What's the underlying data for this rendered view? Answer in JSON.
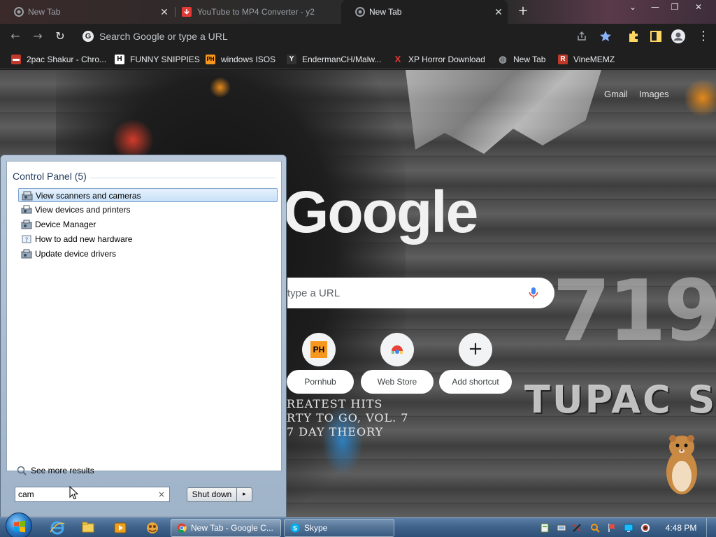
{
  "browser": {
    "tabs": [
      {
        "title": "New Tab",
        "active": false
      },
      {
        "title": "YouTube to MP4 Converter - y2",
        "active": false
      },
      {
        "title": "New Tab",
        "active": true
      }
    ],
    "new_tab_symbol": "+",
    "window_controls": {
      "menu": "⌄",
      "minimize": "—",
      "maximize": "❐",
      "close": "✕"
    },
    "toolbar": {
      "back_icon": "←",
      "forward_icon": "→",
      "reload_icon": "↻",
      "omnibox_placeholder": "Search Google or type a URL",
      "google_letter": "G"
    },
    "bookmarks": [
      {
        "label": "2pac Shakur - Chro...",
        "icon": "page-icon",
        "icon_char": "▬",
        "icon_bg": "#c0392b"
      },
      {
        "label": "FUNNY SNIPPIES",
        "icon": "h-icon",
        "icon_char": "H",
        "icon_bg": "#ffffff"
      },
      {
        "label": "windows ISOS",
        "icon": "ph-icon",
        "icon_char": "PH",
        "icon_bg": "#f7971d"
      },
      {
        "label": "EndermanCH/Malw...",
        "icon": "yp-icon",
        "icon_char": "Y",
        "icon_bg": "#333333"
      },
      {
        "label": "XP Horror Download",
        "icon": "x-icon",
        "icon_char": "X",
        "icon_bg": "#1f1f1f"
      },
      {
        "label": "New Tab",
        "icon": "globe-icon",
        "icon_char": "◍",
        "icon_bg": "#1f1f1f"
      },
      {
        "label": "VineMEMZ",
        "icon": "r-icon",
        "icon_char": "R",
        "icon_bg": "#c0392b"
      }
    ]
  },
  "ntp": {
    "top_links": {
      "gmail": "Gmail",
      "images": "Images"
    },
    "logo_text": "Google",
    "search_placeholder": "type a URL",
    "shortcuts": [
      {
        "label": "Pornhub",
        "icon": "ph-icon",
        "icon_char": "PH"
      },
      {
        "label": "Web Store",
        "icon": "web-store-icon",
        "icon_char": ""
      },
      {
        "label": "Add shortcut",
        "icon": "plus-icon",
        "icon_char": "+"
      }
    ],
    "album_lines": [
      "REATEST HITS",
      "RTY TO GO, VOL. 7",
      "7 DAY THEORY"
    ],
    "big_number": "719",
    "artist_text": "TUPAC SH"
  },
  "start_menu": {
    "section_title": "Control Panel (5)",
    "items": [
      {
        "label": "View scanners and cameras",
        "selected": true
      },
      {
        "label": "View devices and printers",
        "selected": false
      },
      {
        "label": "Device Manager",
        "selected": false
      },
      {
        "label": "How to add new hardware",
        "selected": false
      },
      {
        "label": "Update device drivers",
        "selected": false
      }
    ],
    "see_more": "See more results",
    "search_value": "cam",
    "search_clear": "×",
    "shutdown_label": "Shut down",
    "shutdown_arrow": "▸"
  },
  "taskbar": {
    "tasks": [
      {
        "label": "New Tab - Google C...",
        "active": true
      },
      {
        "label": "Skype",
        "active": false
      }
    ],
    "clock": "4:48 PM"
  },
  "colors": {
    "chrome_dark": "#1f1f1f",
    "star_blue": "#8ab4f8",
    "extension_yellow": "#fdd663",
    "selection_border": "#7da2ce",
    "taskbar_blue": "#3f638b"
  }
}
